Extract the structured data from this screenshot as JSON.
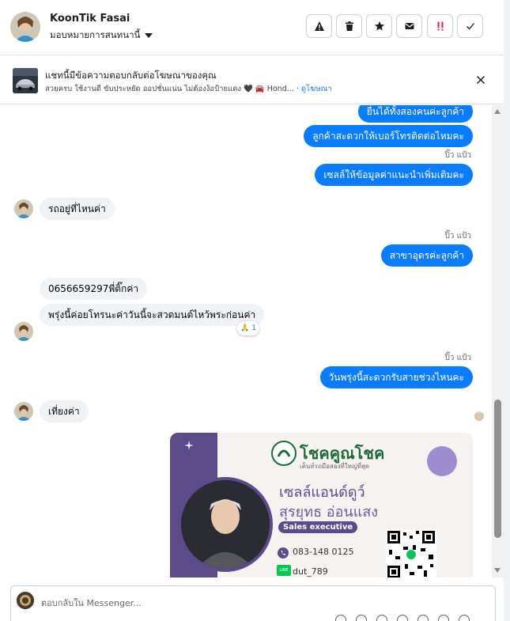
{
  "header": {
    "contact_name": "KoonTik Fasai",
    "assign_label": "มอบหมายการสนทนานี้",
    "actions": [
      {
        "name": "spam-button",
        "icon": "warning-icon"
      },
      {
        "name": "delete-button",
        "icon": "trash-icon"
      },
      {
        "name": "star-button",
        "icon": "star-icon"
      },
      {
        "name": "mark-unread-button",
        "icon": "envelope-icon"
      },
      {
        "name": "follow-up-button",
        "icon": "exclamation-icon"
      },
      {
        "name": "done-button",
        "icon": "check-icon"
      }
    ]
  },
  "ad": {
    "title": "แชทนี้มีข้อความตอบกลับต่อโฆษณาของคุณ",
    "subtitle": "สวยครบ ใช้งานดี ขับประหยัด ออปชั่นแน่น ไม่ต้องง้อป้ายแดง 🖤 🚘 Hond...",
    "link": "ดูโฆษณา"
  },
  "messages": {
    "out1": "ยื่นได้ทั้งสองคนค่ะลูกค้า",
    "out2": "ลูกค้าสะดวกให้เบอร์โทรติดต่อไหมคะ",
    "seen1": "ปิ๊ว แป้ว",
    "out3": "เซลล์ให้ข้อมูลค่าแนะนำเพิ่มเติมคะ",
    "in1": "รถอยู่ที่ไหนค่า",
    "seen2": "ปิ๊ว แป้ว",
    "out4": "สาขาอุดรค่ะลูกค้า",
    "in2": "0656659297พี่ติ๊กค่า",
    "in3": "พรุ่งนี้ค่อยโทรนะค่าวันนี้จะสวดมนต์ไหว้พระก่อนค่า",
    "reaction": "🙏",
    "reaction_count": "1",
    "seen3": "ปิ๊ว แป้ว",
    "out5": "วันพรุ่งนี้สะดวกรับสายช่วงไหนคะ",
    "in4": "เที่ยงค่า"
  },
  "card": {
    "brand": "โชคคูณโชค",
    "tagline": "เต็นท์รถมือสองที่ใหญ่ที่สุด",
    "name_line1": "เซลล์แอนด์ดูว์",
    "name_line2": "สุรยุทธ อ่อนแสง",
    "role": "Sales executive",
    "phone": "083-148 0125",
    "line_badge": "LINE",
    "line_id": "dut_789"
  },
  "composer": {
    "placeholder": "ตอบกลับใน Messenger..."
  },
  "colors": {
    "outgoing": "#0a7cff",
    "incoming": "#f0f2f5",
    "card_purple": "#5b4b8a"
  }
}
